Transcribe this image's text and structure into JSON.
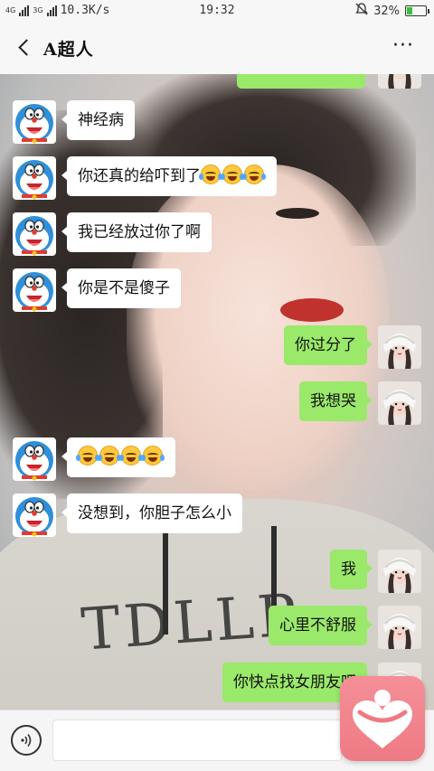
{
  "status_bar": {
    "network": "4G",
    "network2": "3G",
    "speed": "10.3K/s",
    "time": "19:32",
    "battery_percent": "32%",
    "battery_level": 0.32
  },
  "header": {
    "title": "A超人",
    "more_label": "···"
  },
  "messages": [
    {
      "side": "in",
      "text": "神经病",
      "emoji_count": 0
    },
    {
      "side": "in",
      "text": "你还真的给吓到了",
      "emoji_count": 3
    },
    {
      "side": "in",
      "text": "我已经放过你了啊",
      "emoji_count": 0
    },
    {
      "side": "in",
      "text": "你是不是傻子",
      "emoji_count": 0
    },
    {
      "side": "out",
      "text": "你过分了",
      "emoji_count": 0
    },
    {
      "side": "out",
      "text": "我想哭",
      "emoji_count": 0
    },
    {
      "side": "in",
      "text": "",
      "emoji_count": 4
    },
    {
      "side": "in",
      "text": "没想到，你胆子怎么小",
      "emoji_count": 0
    },
    {
      "side": "out",
      "text": "我",
      "emoji_count": 0
    },
    {
      "side": "out",
      "text": "心里不舒服",
      "emoji_count": 0
    },
    {
      "side": "out",
      "text": "你快点找女朋友吧",
      "emoji_count": 0
    }
  ],
  "icons": {
    "back": "chevron-left-icon",
    "more": "more-dots-icon",
    "voice": "voice-icon",
    "emoji": "laughing-crying-emoji",
    "float_app": "heart-app-icon"
  },
  "colors": {
    "outgoing_bubble": "#9ae96a",
    "incoming_bubble": "#ffffff",
    "float_app": "#ee7a84"
  }
}
